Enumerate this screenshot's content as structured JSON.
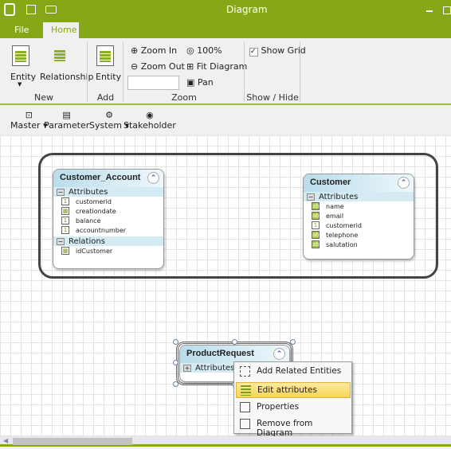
{
  "window": {
    "title": "Diagram",
    "icons": [
      "app-logo-icon",
      "save-icon",
      "print-icon",
      "minimize-icon",
      "maximize-icon"
    ]
  },
  "tabs": [
    {
      "label": "File"
    },
    {
      "label": "Home",
      "active": true
    }
  ],
  "ribbon": {
    "new": {
      "label": "New",
      "entity": "Entity",
      "relationship": "Relationship"
    },
    "add": {
      "label": "Add",
      "entity": "Entity"
    },
    "zoom": {
      "label": "Zoom",
      "zoom_in": "Zoom In",
      "zoom_out": "Zoom Out",
      "hundred": "100%",
      "fit": "Fit Diagram",
      "pan": "Pan",
      "combo_value": ""
    },
    "show_hide": {
      "label": "Show / Hide",
      "show_grid": "Show Grid",
      "show_grid_checked": true
    }
  },
  "toolbar": {
    "items": [
      {
        "label": "Master"
      },
      {
        "label": "Parameter"
      },
      {
        "label": "System"
      },
      {
        "label": "Stakeholder"
      }
    ]
  },
  "entities": {
    "customer_account": {
      "title": "Customer_Account",
      "attributes_label": "Attributes",
      "attributes": [
        {
          "name": "customerid",
          "type": "1"
        },
        {
          "name": "creationdate",
          "type": "date"
        },
        {
          "name": "balance",
          "type": "1"
        },
        {
          "name": "accountnumber",
          "type": "1"
        }
      ],
      "relations_label": "Relations",
      "relations": [
        {
          "name": "idCustomer"
        }
      ]
    },
    "customer": {
      "title": "Customer",
      "attributes_label": "Attributes",
      "attributes": [
        {
          "name": "name",
          "type": "ab"
        },
        {
          "name": "email",
          "type": "ab"
        },
        {
          "name": "customerid",
          "type": "1"
        },
        {
          "name": "telephone",
          "type": "ab"
        },
        {
          "name": "salutation",
          "type": "ab"
        }
      ]
    },
    "product_request": {
      "title": "ProductRequest",
      "attributes_label": "Attributes"
    }
  },
  "context_menu": {
    "items": [
      {
        "label": "Add Related Entities"
      },
      {
        "label": "Edit attributes",
        "highlighted": true
      },
      {
        "label": "Properties"
      },
      {
        "label": "Remove from Diagram"
      }
    ]
  },
  "colors": {
    "accent": "#87a816",
    "entity_header": "#b9dceb",
    "highlight": "#f8d458"
  }
}
